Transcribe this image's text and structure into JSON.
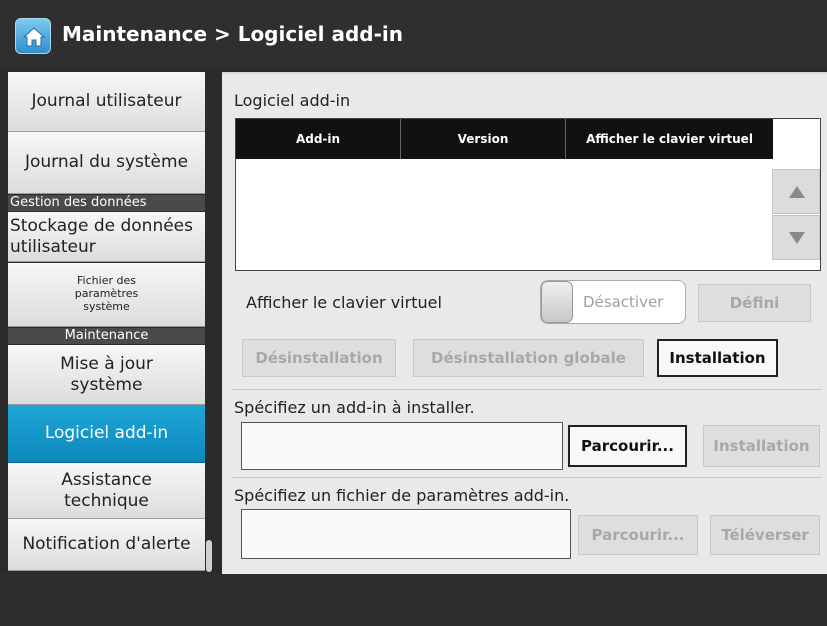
{
  "header": {
    "title": "Maintenance > Logiciel add-in",
    "home_icon": "home-icon"
  },
  "sidebar": {
    "items": [
      {
        "label": "Journal utilisateur"
      },
      {
        "label": "Journal du système"
      },
      {
        "section": "Gestion des données"
      },
      {
        "label": "Stockage de données utilisateur"
      },
      {
        "label": "Fichier des paramètres système"
      },
      {
        "section": "Maintenance"
      },
      {
        "label": "Mise à jour système"
      },
      {
        "label": "Logiciel add-in",
        "active": true
      },
      {
        "label": "Assistance technique"
      },
      {
        "label": "Notification d'alerte"
      }
    ]
  },
  "main": {
    "section_title": "Logiciel add-in",
    "table": {
      "columns": [
        "Add-in",
        "Version",
        "Afficher le clavier virtuel"
      ],
      "rows": []
    },
    "keyboard": {
      "label": "Afficher le clavier virtuel",
      "toggle_label": "Désactiver",
      "set_button": "Défini"
    },
    "actions": {
      "uninstall": "Désinstallation",
      "uninstall_all": "Désinstallation globale",
      "install": "Installation"
    },
    "install_section": {
      "label": "Spécifiez un add-in à installer.",
      "browse": "Parcourir...",
      "install": "Installation",
      "value": ""
    },
    "settings_section": {
      "label": "Spécifiez un fichier de paramètres add-in.",
      "browse": "Parcourir...",
      "upload": "Téléverser",
      "value": ""
    }
  },
  "colors": {
    "accent": "#1397c9",
    "header_bg": "#2f2f2f",
    "panel_bg": "#e9e9e9"
  }
}
